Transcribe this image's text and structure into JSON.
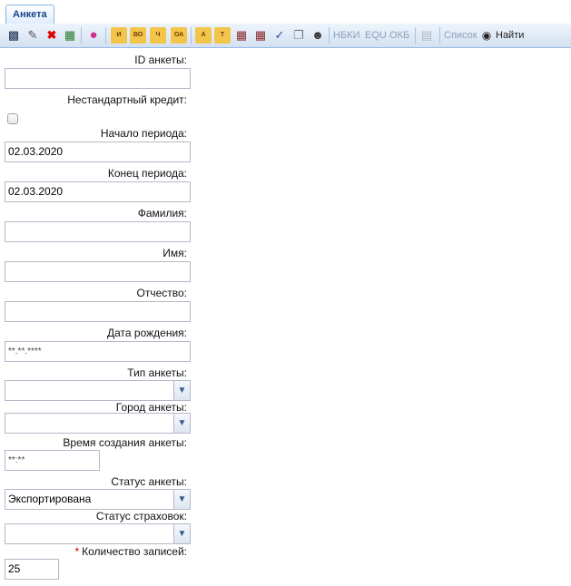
{
  "tab": {
    "label": "Анкета"
  },
  "toolbar": {
    "buttons": [
      "И",
      "ВО",
      "Ч",
      "ОА",
      "А",
      "Т"
    ],
    "nbki": "НБКИ",
    "equ": "EQU",
    "okb": "ОКБ",
    "list": "Список",
    "find": "Найти"
  },
  "form": {
    "id_label": "ID анкеты:",
    "id_value": "",
    "nonstd_label": "Нестандартный кредит:",
    "start_label": "Начало периода:",
    "start_value": "02.03.2020",
    "end_label": "Конец периода:",
    "end_value": "02.03.2020",
    "lastname_label": "Фамилия:",
    "lastname_value": "",
    "firstname_label": "Имя:",
    "firstname_value": "",
    "middlename_label": "Отчество:",
    "middlename_value": "",
    "birth_label": "Дата рождения:",
    "birth_value": "**.**.****",
    "type_label": "Тип анкеты:",
    "type_value": "",
    "city_label": "Город анкеты:",
    "city_value": "",
    "created_label": "Время создания анкеты:",
    "created_value": "**:**",
    "status_label": "Статус анкеты:",
    "status_value": "Экспортирована",
    "ins_label": "Статус страховок:",
    "ins_value": "",
    "count_required_mark": "*",
    "count_label": "Количество записей:",
    "count_value": "25"
  }
}
